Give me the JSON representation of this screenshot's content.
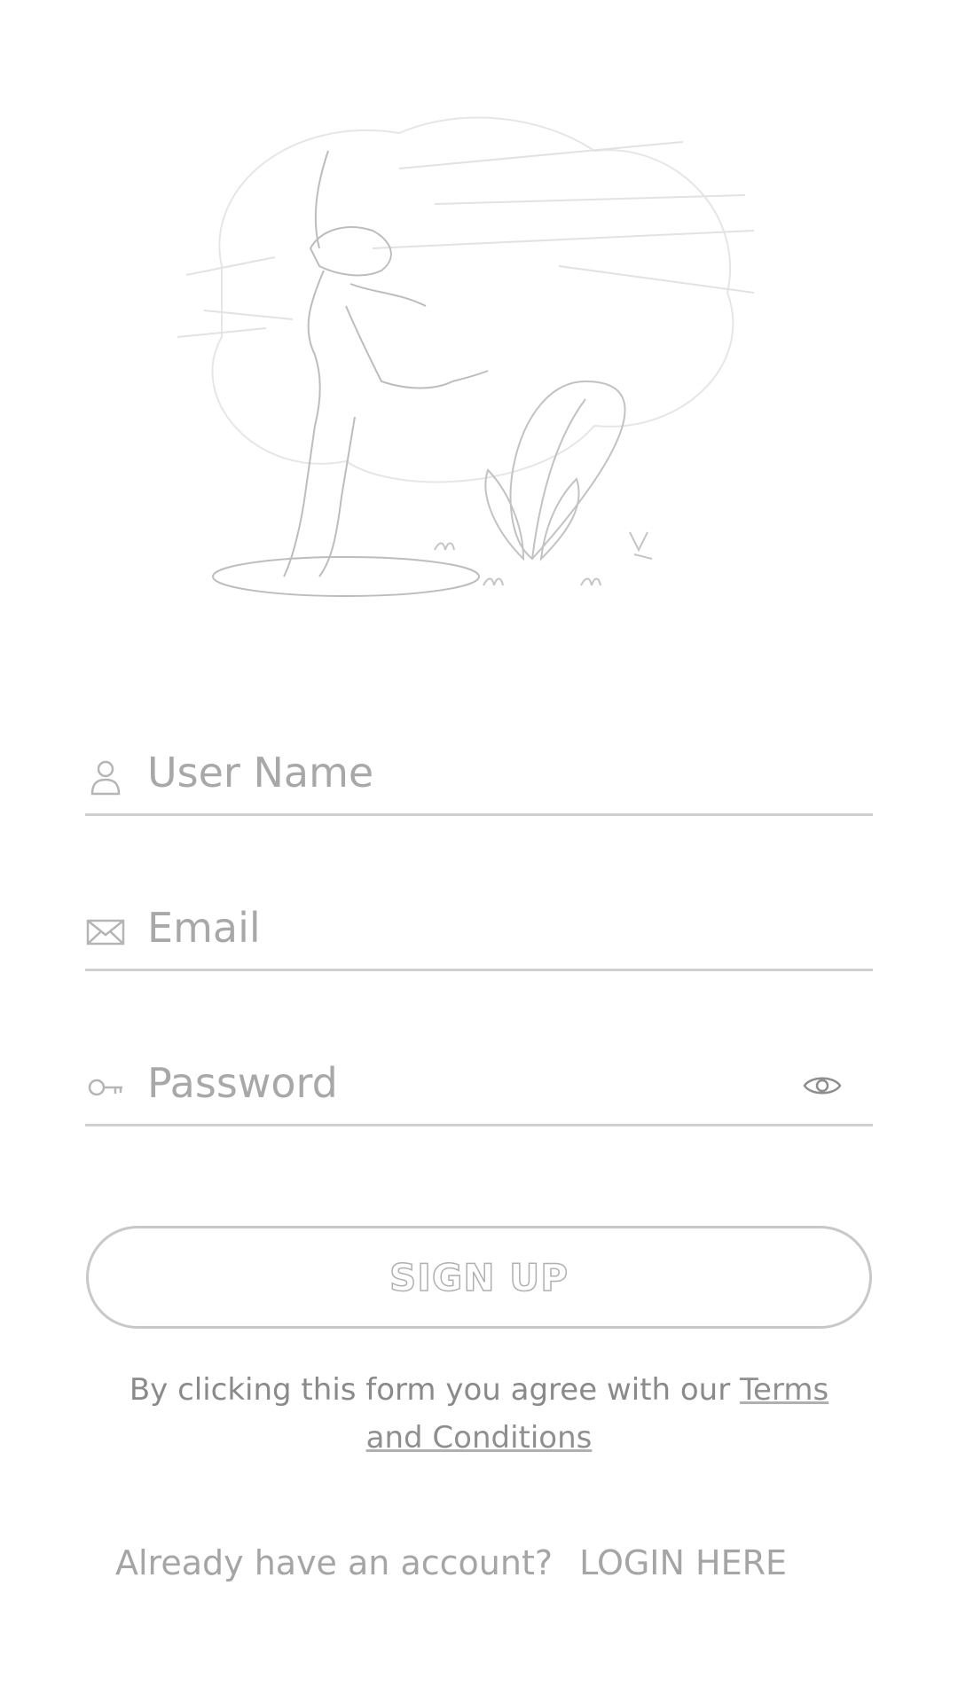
{
  "form": {
    "username_placeholder": "User Name",
    "email_placeholder": "Email",
    "password_placeholder": "Password"
  },
  "actions": {
    "signup_label": "SIGN UP"
  },
  "terms": {
    "prefix": "By clicking this form you agree with our",
    "link_label": "Terms and Conditions"
  },
  "login": {
    "prompt": "Already have an account?",
    "link_label": "LOGIN HERE"
  },
  "icons": {
    "username": "user-icon",
    "email": "envelope-icon",
    "password": "key-icon",
    "toggle": "eye-icon"
  },
  "colors": {
    "line": "#cfcfcf",
    "text": "#9a9a9a"
  }
}
